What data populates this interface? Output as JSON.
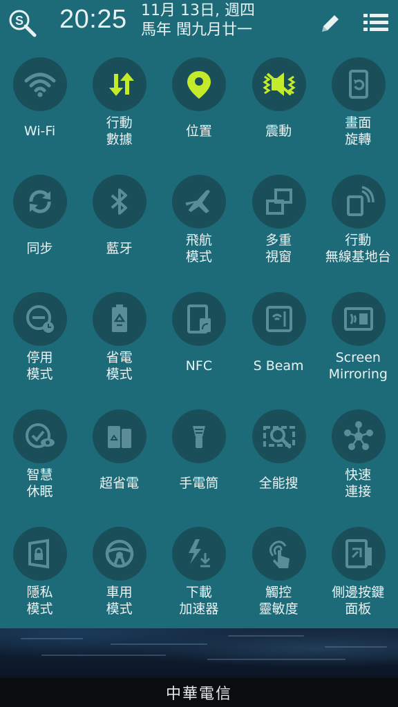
{
  "header": {
    "time": "20:25",
    "date_line1": "11月 13日, 週四",
    "date_line2": "馬年 閏九月廿一"
  },
  "colors": {
    "background": "#1d6a78",
    "tile_circle": "#1a4f59",
    "active_icon": "#c4ea2c",
    "inactive_icon": "#5a8d97"
  },
  "tiles": [
    {
      "label": "Wi-Fi",
      "icon": "wifi-icon",
      "active": false
    },
    {
      "label": "行動\n數據",
      "icon": "mobile-data-icon",
      "active": true
    },
    {
      "label": "位置",
      "icon": "location-icon",
      "active": true
    },
    {
      "label": "震動",
      "icon": "vibrate-icon",
      "active": true
    },
    {
      "label": "畫面\n旋轉",
      "icon": "screen-rotation-icon",
      "active": false
    },
    {
      "label": "同步",
      "icon": "sync-icon",
      "active": false
    },
    {
      "label": "藍牙",
      "icon": "bluetooth-icon",
      "active": false
    },
    {
      "label": "飛航\n模式",
      "icon": "airplane-icon",
      "active": false
    },
    {
      "label": "多重\n視窗",
      "icon": "multi-window-icon",
      "active": false
    },
    {
      "label": "行動\n無線基地台",
      "icon": "hotspot-icon",
      "active": false
    },
    {
      "label": "停用\n模式",
      "icon": "blocking-mode-icon",
      "active": false
    },
    {
      "label": "省電\n模式",
      "icon": "power-saving-icon",
      "active": false
    },
    {
      "label": "NFC",
      "icon": "nfc-icon",
      "active": false
    },
    {
      "label": "S Beam",
      "icon": "s-beam-icon",
      "active": false
    },
    {
      "label": "Screen\nMirroring",
      "icon": "screen-mirroring-icon",
      "active": false
    },
    {
      "label": "智慧\n休眠",
      "icon": "smart-stay-icon",
      "active": false
    },
    {
      "label": "超省電",
      "icon": "ultra-power-saving-icon",
      "active": false
    },
    {
      "label": "手電筒",
      "icon": "flashlight-icon",
      "active": false
    },
    {
      "label": "全能搜",
      "icon": "s-finder-search-icon",
      "active": false
    },
    {
      "label": "快速\n連接",
      "icon": "quick-connect-icon",
      "active": false
    },
    {
      "label": "隱私\n模式",
      "icon": "private-mode-icon",
      "active": false
    },
    {
      "label": "車用\n模式",
      "icon": "car-mode-icon",
      "active": false
    },
    {
      "label": "下載\n加速器",
      "icon": "download-booster-icon",
      "active": false
    },
    {
      "label": "觸控\n靈敏度",
      "icon": "touch-sensitivity-icon",
      "active": false
    },
    {
      "label": "側邊按鍵\n面板",
      "icon": "side-key-panel-icon",
      "active": false
    }
  ],
  "footer": {
    "carrier": "中華電信"
  }
}
